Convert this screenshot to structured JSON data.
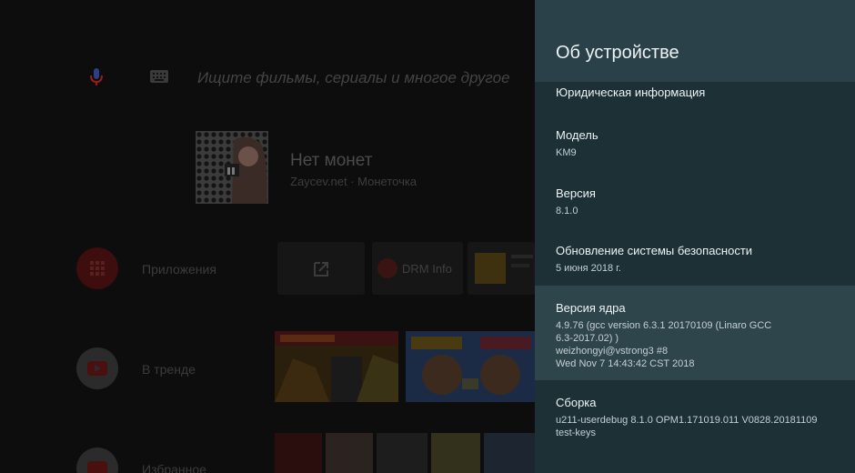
{
  "search": {
    "placeholder": "Ищите фильмы, сериалы и многое другое"
  },
  "now_playing": {
    "title": "Нет монет",
    "subtitle": "Zaycev.net · Монеточка"
  },
  "rows": [
    {
      "label": "Приложения",
      "icon": "apps-grid-icon",
      "color": "#c41f1f"
    },
    {
      "label": "В тренде",
      "icon": "youtube-icon",
      "color": "#2c2c2c"
    },
    {
      "label": "Избранное",
      "icon": "youtube-icon",
      "color": "#2c2c2c"
    }
  ],
  "apps": {
    "drm_label": "DRM Info"
  },
  "settings": {
    "title": "Об устройстве",
    "legal": "Юридическая информация",
    "items": [
      {
        "label": "Модель",
        "value": "KM9"
      },
      {
        "label": "Версия",
        "value": "8.1.0"
      },
      {
        "label": "Обновление системы безопасности",
        "value": "5 июня 2018 г."
      },
      {
        "label": "Версия ядра",
        "value": "4.9.76 (gcc version 6.3.1 20170109 (Linaro GCC\n6.3-2017.02) )\nweizhongyi@vstrong3 #8\nWed Nov 7 14:43:42 CST 2018"
      },
      {
        "label": "Сборка",
        "value": "u211-userdebug 8.1.0 OPM1.171019.011 V0828.20181109\ntest-keys"
      }
    ]
  },
  "colors": {
    "panel_bg": "#1c3036",
    "panel_header": "#2a4149",
    "selected_item": "#2f454c",
    "apps_red": "#c41f1f"
  }
}
